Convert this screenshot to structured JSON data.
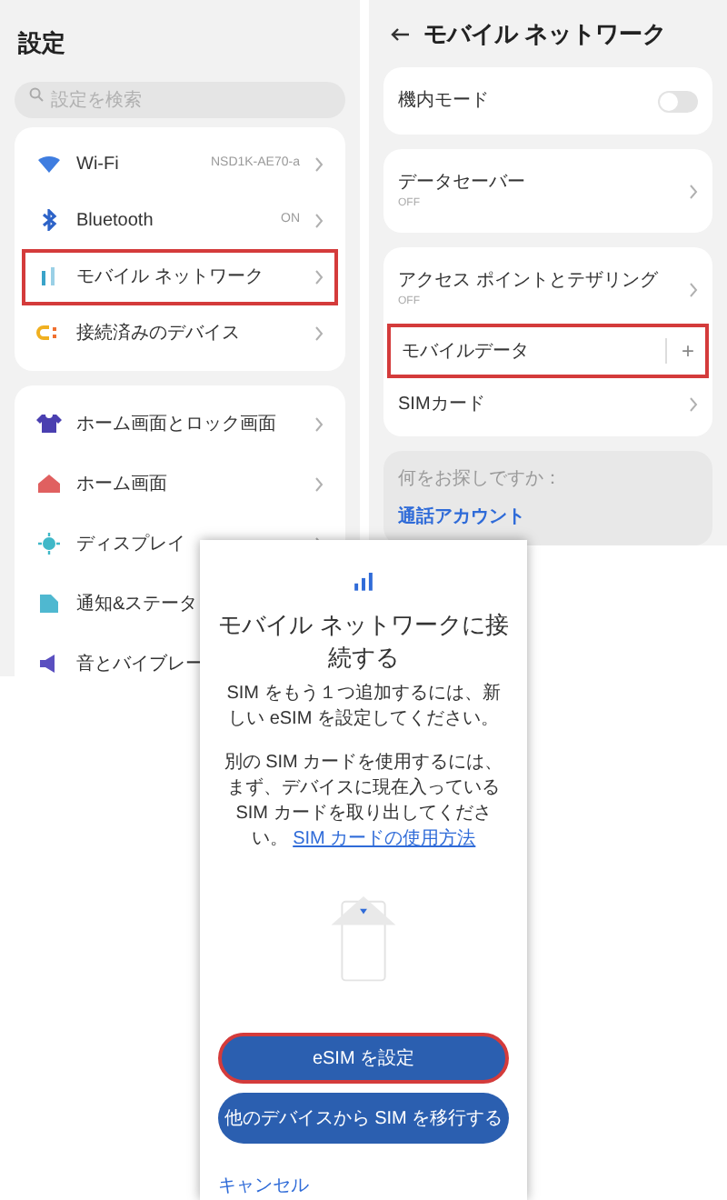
{
  "settings": {
    "title": "設定",
    "search": {
      "placeholder": "設定を検索"
    },
    "groups": [
      {
        "items": [
          {
            "label": "Wi-Fi",
            "value": "NSD1K-AE70-a",
            "highlighted": false,
            "chevron": true
          },
          {
            "label": "Bluetooth",
            "value": "ON",
            "highlighted": false,
            "chevron": true
          },
          {
            "label": "モバイル ネットワーク",
            "highlighted": true,
            "chevron": true
          },
          {
            "label": "接続済みのデバイス",
            "highlighted": false,
            "chevron": true
          }
        ]
      },
      {
        "items": [
          {
            "label": "ホーム画面とロック画面",
            "highlighted": false,
            "chevron": true
          },
          {
            "label": "ホーム画面",
            "highlighted": false,
            "chevron": true
          },
          {
            "label": "ディスプレイ",
            "highlighted": false,
            "chevron": true
          },
          {
            "label": "通知&ステータ",
            "highlighted": false,
            "chevron": false
          },
          {
            "label": "音とバイブレー",
            "highlighted": false,
            "chevron": false
          }
        ]
      }
    ]
  },
  "mobile_network": {
    "title": "モバイル ネットワーク",
    "groups": [
      {
        "items": [
          {
            "kind": "toggle",
            "label": "機内モード",
            "on": false
          }
        ]
      },
      {
        "items": [
          {
            "kind": "nav",
            "label": "データセーバー",
            "sublabel": "OFF"
          }
        ]
      },
      {
        "items": [
          {
            "kind": "nav",
            "label": "アクセス ポイントとテザリング",
            "sublabel": "OFF"
          },
          {
            "kind": "expand",
            "label": "モバイルデータ",
            "action": "+",
            "highlighted": true
          },
          {
            "kind": "nav",
            "label": "SIMカード"
          }
        ]
      }
    ],
    "help": {
      "question": "何をお探しですか：",
      "link": "通話アカウント"
    }
  },
  "dialog": {
    "title": "モバイル ネットワークに接続する",
    "paragraphs": [
      "SIM をもう１つ追加するには、新しい eSIM を設定してください。",
      "別の SIM カードを使用するには、まず、デバイスに現在入っている SIM カードを取り出してください。"
    ],
    "link": "SIM カードの使用方法",
    "buttons": [
      {
        "label": "eSIM を設定",
        "highlighted": true
      },
      {
        "label": "他のデバイスから SIM を移行する",
        "highlighted": false
      }
    ],
    "cancel": "キャンセル"
  }
}
